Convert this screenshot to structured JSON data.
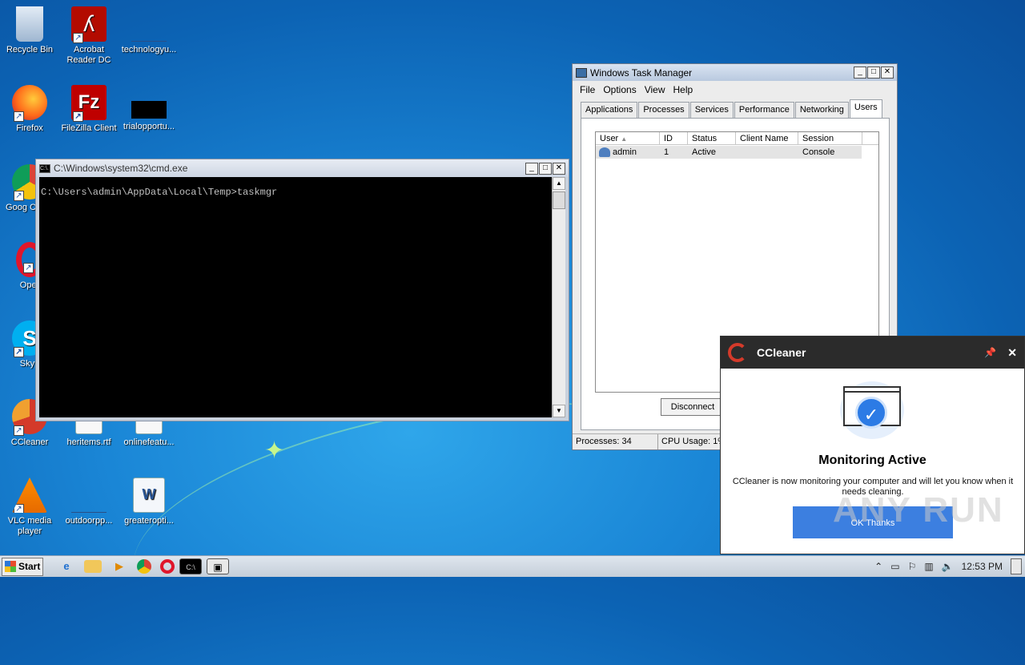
{
  "desktop": {
    "icons": [
      {
        "label": "Recycle Bin"
      },
      {
        "label": "Acrobat Reader DC"
      },
      {
        "label": "technologyu..."
      },
      {
        "label": "Firefox"
      },
      {
        "label": "FileZilla Client"
      },
      {
        "label": "trialopportu..."
      },
      {
        "label": "Goog Chron"
      },
      {
        "label": "Oper"
      },
      {
        "label": "Skyp"
      },
      {
        "label": "CCleaner"
      },
      {
        "label": "heritems.rtf"
      },
      {
        "label": "onlinefeatu..."
      },
      {
        "label": "VLC media player"
      },
      {
        "label": "outdoorpp..."
      },
      {
        "label": "greateropti..."
      }
    ]
  },
  "cmd": {
    "title": "C:\\Windows\\system32\\cmd.exe",
    "console_line": "C:\\Users\\admin\\AppData\\Local\\Temp>taskmgr",
    "icon_text": "C:\\."
  },
  "taskmanager": {
    "title": "Windows Task Manager",
    "menu": [
      "File",
      "Options",
      "View",
      "Help"
    ],
    "tabs": [
      "Applications",
      "Processes",
      "Services",
      "Performance",
      "Networking",
      "Users"
    ],
    "active_tab": "Users",
    "columns": [
      "User",
      "ID",
      "Status",
      "Client Name",
      "Session"
    ],
    "rows": [
      {
        "user": "admin",
        "id": "1",
        "status": "Active",
        "client": "",
        "session": "Console"
      }
    ],
    "disconnect_label": "Disconnect",
    "status_processes": "Processes: 34",
    "status_cpu": "CPU Usage: 1%"
  },
  "ccleaner": {
    "app_name": "CCleaner",
    "heading": "Monitoring Active",
    "message": "CCleaner is now monitoring your computer and will let you know when it needs cleaning.",
    "ok_label": "OK Thanks"
  },
  "watermark": "ANY RUN",
  "taskbar": {
    "start_label": "Start",
    "clock": "12:53 PM"
  }
}
